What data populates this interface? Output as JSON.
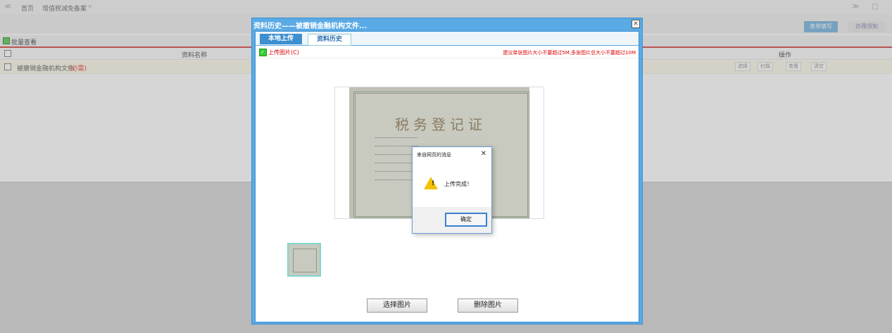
{
  "tabs": {
    "nav_left": "≪",
    "home": "首页",
    "current": "增值税减免备案",
    "close": "×",
    "nav_right": "≫",
    "window_btn": "□"
  },
  "steps": {
    "fill_form": "表单填写",
    "notice": "办理须知"
  },
  "grid": {
    "batch_view": "批量查看",
    "col_name": "资料名称",
    "col_ops": "操作",
    "row_name": "被撤销金融机构文件",
    "row_required": "(必需)",
    "ops": {
      "select": "选择",
      "scan": "扫描",
      "view": "查看",
      "clear": "清空"
    }
  },
  "dialog": {
    "title": "资料历史——被撤销金融机构文件...",
    "close": "×",
    "tab_local": "本地上传",
    "tab_history": "资料历史",
    "upload_label": "上传图片(C)",
    "upload_note": "建议单张图片大小不要超过5M,多张图片总大小不要超过10M",
    "cert_title": "税务登记证",
    "select_image": "选择图片",
    "delete_image": "删除图片"
  },
  "message": {
    "title": "来自网页的消息",
    "close": "✕",
    "text": "上传完成！",
    "ok": "确定"
  },
  "colors": {
    "accent": "#5aaae6",
    "required_red": "#d9534f",
    "warning": "#f2c200"
  }
}
